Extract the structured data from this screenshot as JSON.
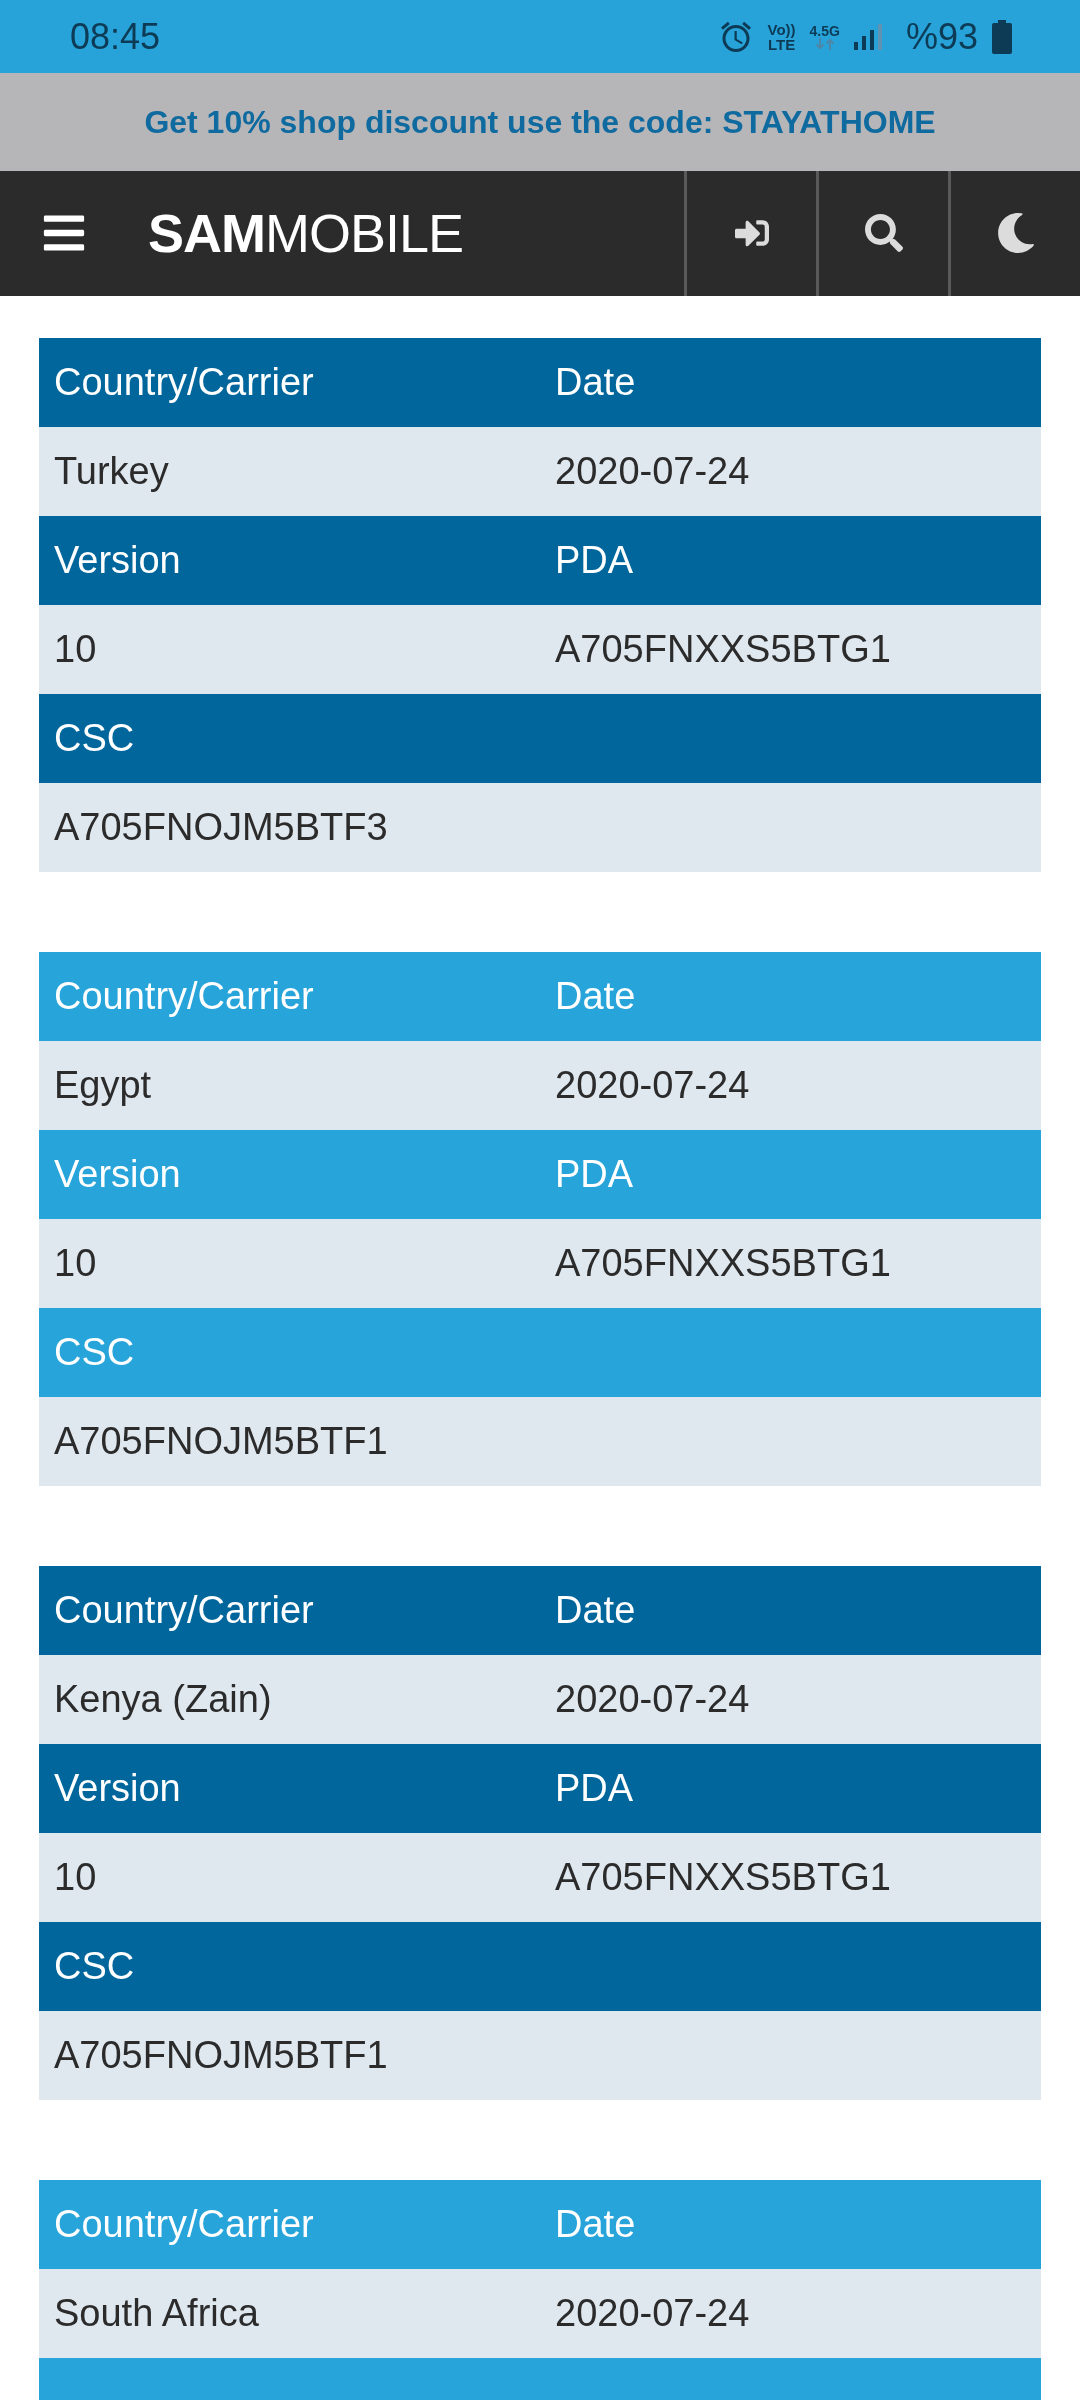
{
  "status_bar": {
    "time": "08:45",
    "volte_top": "Vo))",
    "volte_bottom": "LTE",
    "network_type": "4.5G",
    "battery": "%93"
  },
  "promo_banner": {
    "text": "Get 10% shop discount use the code: STAYATHOME"
  },
  "header": {
    "logo": "**SAM**MOBILE"
  },
  "tables": [
    {
      "color": "#00669b",
      "rows": [
        {
          "kind": "header",
          "cells": [
            "Country/Carrier",
            "Date"
          ]
        },
        {
          "kind": "data",
          "cells": [
            "Turkey",
            "2020-07-24"
          ]
        },
        {
          "kind": "header",
          "cells": [
            "Version",
            "PDA"
          ]
        },
        {
          "kind": "data",
          "cells": [
            "10",
            "A705FNXXS5BTG1"
          ]
        },
        {
          "kind": "header",
          "cells": [
            "CSC"
          ]
        },
        {
          "kind": "data",
          "cells": [
            "A705FNOJM5BTF3"
          ]
        }
      ]
    },
    {
      "color": "#27a4da",
      "rows": [
        {
          "kind": "header",
          "cells": [
            "Country/Carrier",
            "Date"
          ]
        },
        {
          "kind": "data",
          "cells": [
            "Egypt",
            "2020-07-24"
          ]
        },
        {
          "kind": "header",
          "cells": [
            "Version",
            "PDA"
          ]
        },
        {
          "kind": "data",
          "cells": [
            "10",
            "A705FNXXS5BTG1"
          ]
        },
        {
          "kind": "header",
          "cells": [
            "CSC"
          ]
        },
        {
          "kind": "data",
          "cells": [
            "A705FNOJM5BTF1"
          ]
        }
      ]
    },
    {
      "color": "#00669b",
      "rows": [
        {
          "kind": "header",
          "cells": [
            "Country/Carrier",
            "Date"
          ]
        },
        {
          "kind": "data",
          "cells": [
            "Kenya (Zain)",
            "2020-07-24"
          ]
        },
        {
          "kind": "header",
          "cells": [
            "Version",
            "PDA"
          ]
        },
        {
          "kind": "data",
          "cells": [
            "10",
            "A705FNXXS5BTG1"
          ]
        },
        {
          "kind": "header",
          "cells": [
            "CSC"
          ]
        },
        {
          "kind": "data",
          "cells": [
            "A705FNOJM5BTF1"
          ]
        }
      ]
    },
    {
      "color": "#27a4da",
      "rows": [
        {
          "kind": "header",
          "cells": [
            "Country/Carrier",
            "Date"
          ]
        },
        {
          "kind": "data",
          "cells": [
            "South Africa",
            "2020-07-24"
          ]
        },
        {
          "kind": "header"
        }
      ]
    }
  ]
}
